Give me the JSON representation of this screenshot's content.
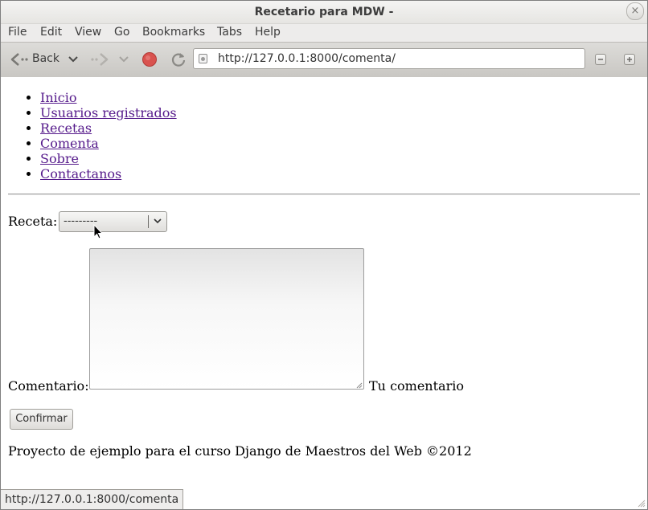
{
  "window": {
    "title": "Recetario para MDW -",
    "close_glyph": "×"
  },
  "menubar": {
    "items": [
      "File",
      "Edit",
      "View",
      "Go",
      "Bookmarks",
      "Tabs",
      "Help"
    ]
  },
  "toolbar": {
    "back_label": "Back",
    "url": "http://127.0.0.1:8000/comenta/"
  },
  "page": {
    "nav": [
      "Inicio",
      "Usuarios registrados",
      "Recetas",
      "Comenta",
      "Sobre",
      "Contactanos"
    ],
    "receta_label": "Receta:",
    "receta_selected": "---------",
    "comentario_label": "Comentario:",
    "comentario_value": "",
    "comentario_help": "Tu comentario",
    "submit_label": "Confirmar",
    "footer": "Proyecto de ejemplo para el curso Django de Maestros del Web ©2012"
  },
  "statusbar": {
    "text": "http://127.0.0.1:8000/comenta"
  },
  "colors": {
    "link_visited": "#551a8b",
    "stop_red": "#d9534f"
  }
}
